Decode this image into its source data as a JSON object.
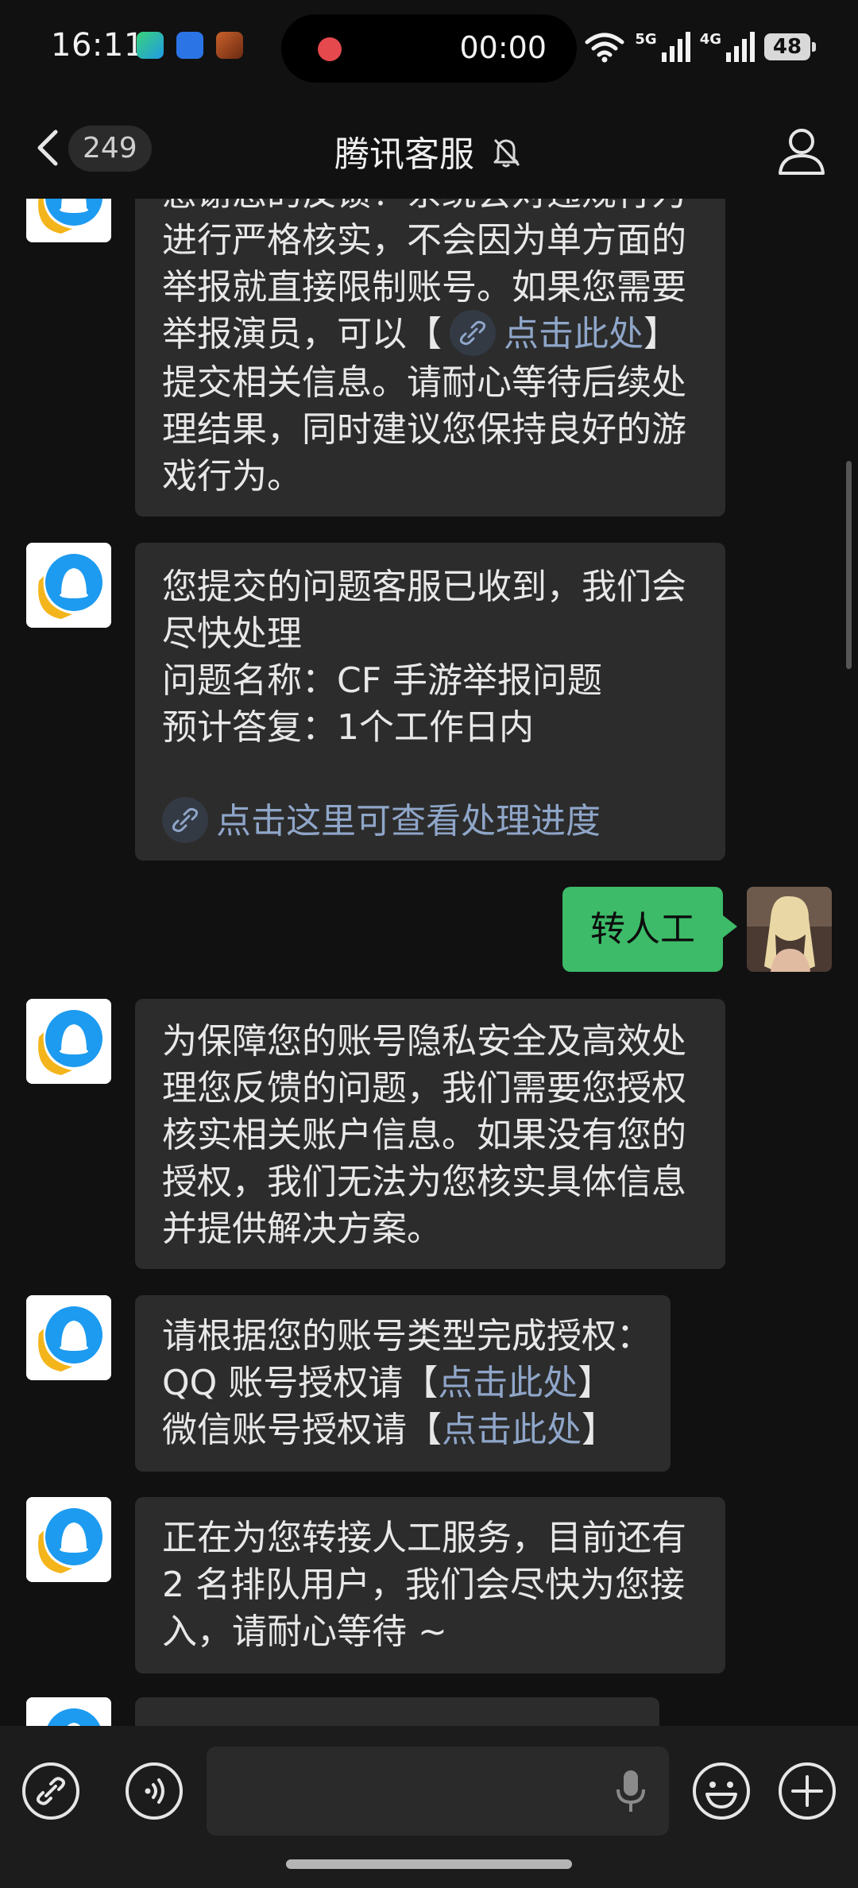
{
  "status_bar": {
    "time": "16:11",
    "recording_time": "00:00",
    "network_1": "5G",
    "network_2": "4G",
    "battery": "48",
    "app_icons": [
      "app-icon",
      "yupao-live-icon",
      "game-icon"
    ]
  },
  "header": {
    "unread_count": "249",
    "title": "腾讯客服",
    "icons": [
      "back-icon",
      "bell-muted-icon",
      "profile-icon"
    ]
  },
  "messages": {
    "m1": {
      "lines": [
        "感谢您的反馈！系统会对违规行为",
        "进行严格核实，不会因为单方面的",
        "举报就直接限制账号。如果您需要",
        "提交相关信息。请耐心等待后续处",
        "理结果，同时建议您保持良好的游",
        "戏行为。"
      ],
      "line4_prefix": "举报演员，可以【",
      "line4_link": "点击此处",
      "line4_suffix": "】"
    },
    "m2": {
      "lines": [
        "您提交的问题客服已收到，我们会",
        "尽快处理",
        "问题名称：CF 手游举报问题",
        "预计答复：1个工作日内"
      ],
      "link": "点击这里可查看处理进度"
    },
    "m3": {
      "text": "转人工"
    },
    "m4": {
      "lines": [
        "为保障您的账号隐私安全及高效处",
        "理您反馈的问题，我们需要您授权",
        "核实相关账户信息。如果没有您的",
        "授权，我们无法为您核实具体信息",
        "并提供解决方案。"
      ]
    },
    "m5": {
      "line1": "请根据您的账号类型完成授权：",
      "line2_prefix": "QQ 账号授权请【",
      "line2_link": "点击此处",
      "line2_suffix": "】",
      "line3_prefix": "微信账号授权请【",
      "line3_link": "点击此处",
      "line3_suffix": "】"
    },
    "m6": {
      "lines": [
        "正在为您转接人工服务，目前还有",
        "2 名排队用户，我们会尽快为您接",
        "入，请耐心等待 ~"
      ]
    }
  },
  "input_bar": {
    "icons": [
      "link-icon",
      "voice-icon",
      "mic-icon",
      "emoji-icon",
      "plus-icon"
    ]
  },
  "colors": {
    "background": "#111111",
    "bubble": "#2c2c2c",
    "user_bubble": "#3dbb69",
    "link": "#8fa6c9"
  }
}
